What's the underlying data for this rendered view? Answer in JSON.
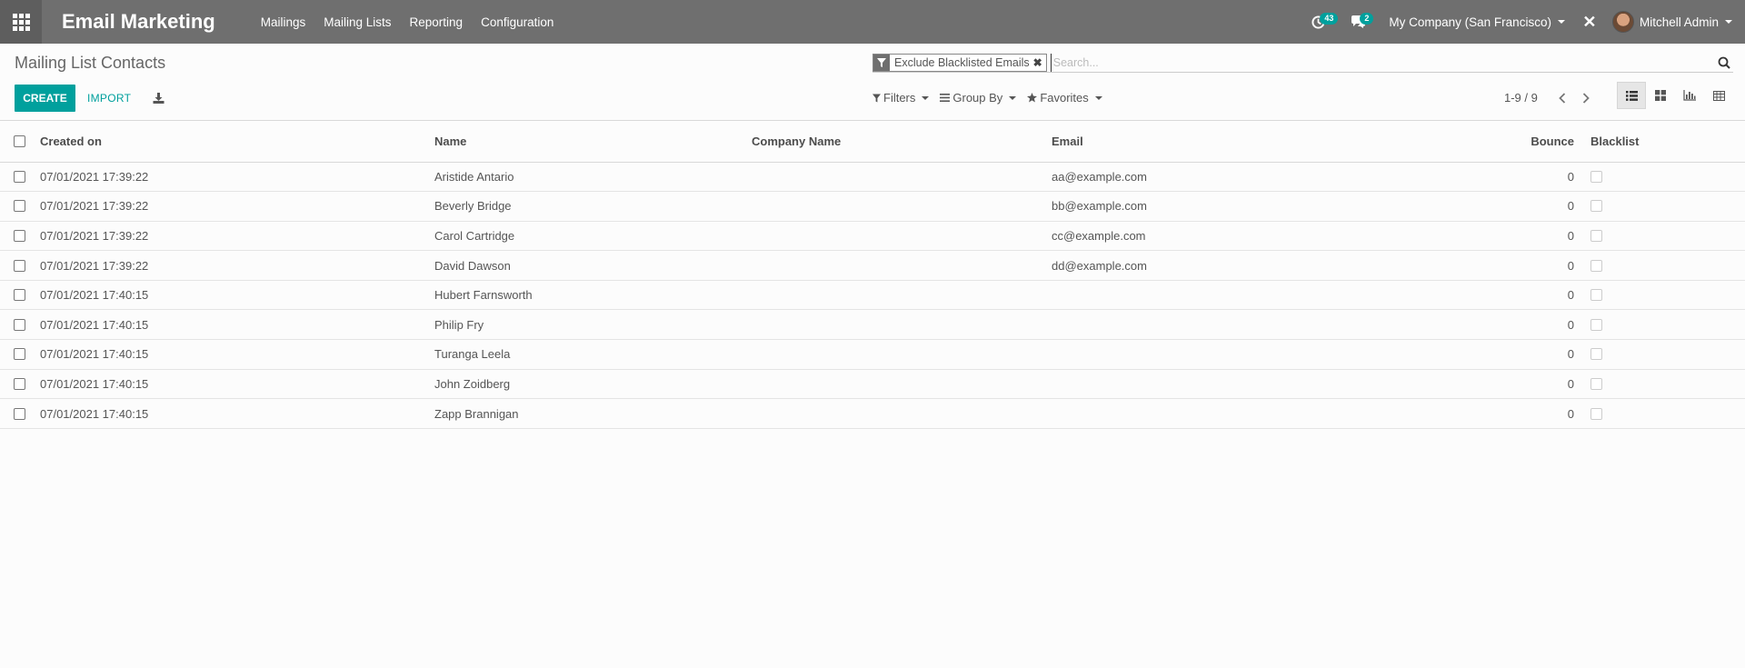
{
  "navbar": {
    "app_title": "Email Marketing",
    "menu": [
      "Mailings",
      "Mailing Lists",
      "Reporting",
      "Configuration"
    ],
    "activity_count": "43",
    "message_count": "2",
    "company": "My Company (San Francisco)",
    "user": "Mitchell Admin",
    "bg_color": "#6f6f6f",
    "accent_color": "#00a09d"
  },
  "control": {
    "title": "Mailing List Contacts",
    "create_label": "CREATE",
    "import_label": "IMPORT",
    "search_facet": "Exclude Blacklisted Emails",
    "search_placeholder": "Search...",
    "filters_label": "Filters",
    "groupby_label": "Group By",
    "favorites_label": "Favorites",
    "pager": "1-9 / 9",
    "views": [
      "list-view-icon",
      "kanban-view-icon",
      "graph-view-icon",
      "pivot-view-icon"
    ],
    "active_view": "list"
  },
  "table": {
    "headers": {
      "created": "Created on",
      "name": "Name",
      "company": "Company Name",
      "email": "Email",
      "bounce": "Bounce",
      "blacklist": "Blacklist"
    },
    "rows": [
      {
        "created": "07/01/2021 17:39:22",
        "name": "Aristide Antario",
        "company": "",
        "email": "aa@example.com",
        "bounce": "0",
        "blacklist": false
      },
      {
        "created": "07/01/2021 17:39:22",
        "name": "Beverly Bridge",
        "company": "",
        "email": "bb@example.com",
        "bounce": "0",
        "blacklist": false
      },
      {
        "created": "07/01/2021 17:39:22",
        "name": "Carol Cartridge",
        "company": "",
        "email": "cc@example.com",
        "bounce": "0",
        "blacklist": false
      },
      {
        "created": "07/01/2021 17:39:22",
        "name": "David Dawson",
        "company": "",
        "email": "dd@example.com",
        "bounce": "0",
        "blacklist": false
      },
      {
        "created": "07/01/2021 17:40:15",
        "name": "Hubert Farnsworth",
        "company": "",
        "email": "",
        "bounce": "0",
        "blacklist": false
      },
      {
        "created": "07/01/2021 17:40:15",
        "name": "Philip Fry",
        "company": "",
        "email": "",
        "bounce": "0",
        "blacklist": false
      },
      {
        "created": "07/01/2021 17:40:15",
        "name": "Turanga Leela",
        "company": "",
        "email": "",
        "bounce": "0",
        "blacklist": false
      },
      {
        "created": "07/01/2021 17:40:15",
        "name": "John Zoidberg",
        "company": "",
        "email": "",
        "bounce": "0",
        "blacklist": false
      },
      {
        "created": "07/01/2021 17:40:15",
        "name": "Zapp Brannigan",
        "company": "",
        "email": "",
        "bounce": "0",
        "blacklist": false
      }
    ]
  }
}
